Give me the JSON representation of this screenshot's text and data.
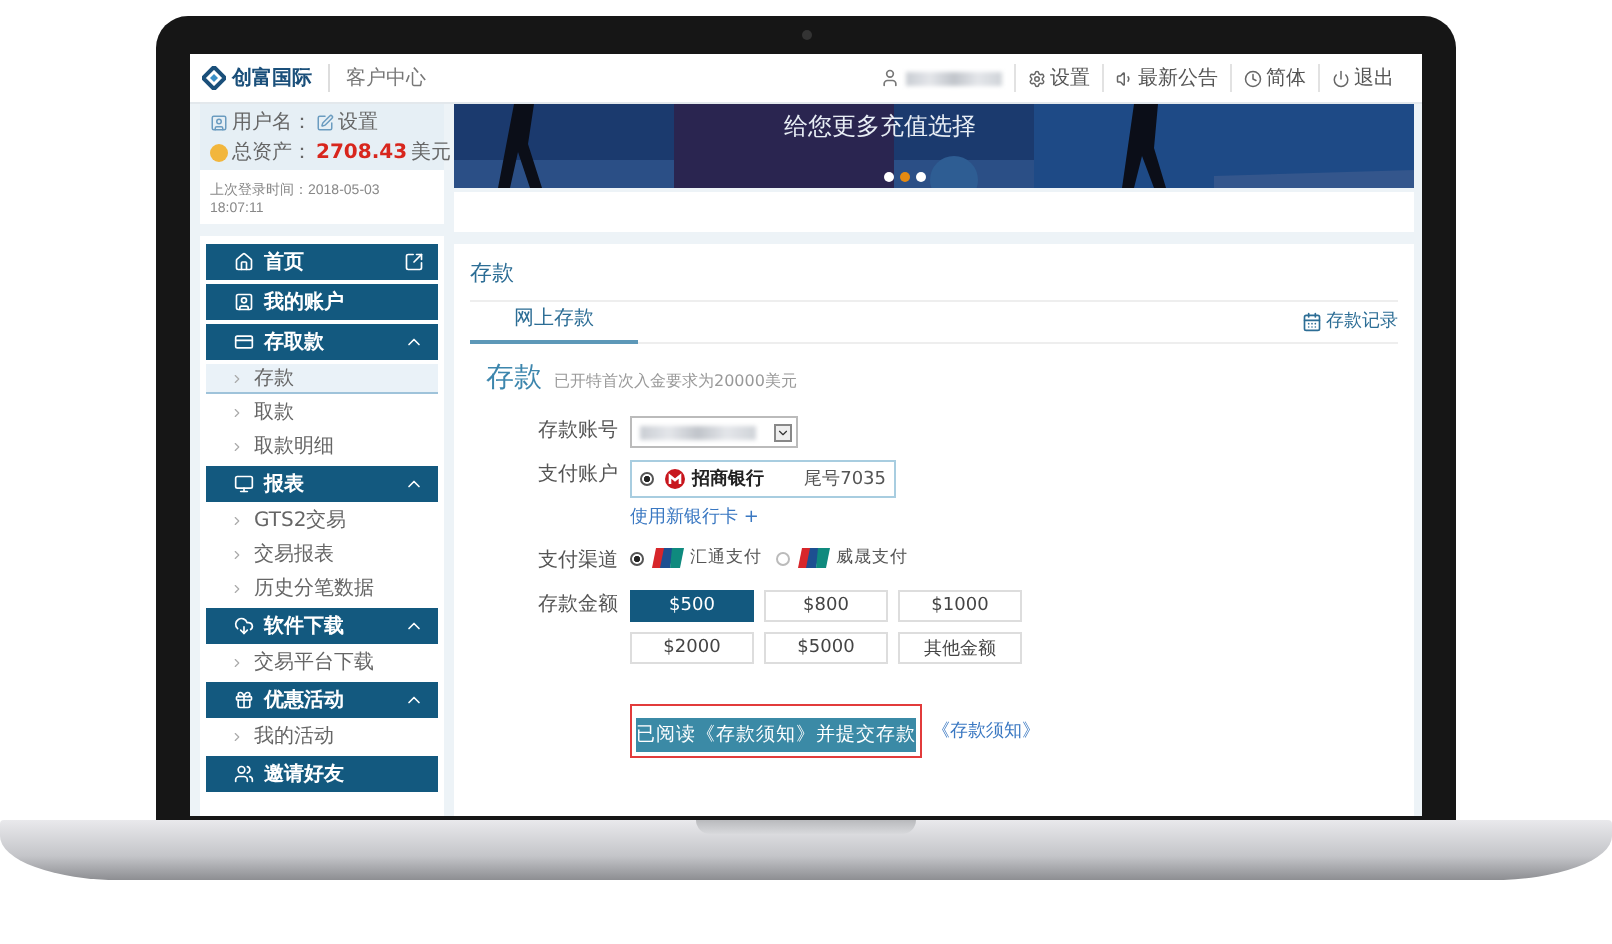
{
  "header": {
    "brand": "创富国际",
    "section": "客户中心",
    "actions": [
      {
        "label": "设置"
      },
      {
        "label": "最新公告"
      },
      {
        "label": "简体"
      },
      {
        "label": "退出"
      }
    ]
  },
  "account": {
    "username_label": "用户名：",
    "settings_link": "设置",
    "assets_label": "总资产：",
    "assets_value": "2708.43",
    "assets_unit": "美元",
    "last_login": "上次登录时间：2018-05-03 18:07:11"
  },
  "banner": {
    "caption": "给您更多充值选择",
    "dots": [
      {
        "selected": false
      },
      {
        "selected": true
      },
      {
        "selected": false
      }
    ]
  },
  "sidebar": {
    "groups": [
      {
        "label": "首页",
        "kind": "shortcut"
      },
      {
        "label": "我的账户",
        "kind": "link"
      },
      {
        "label": "存取款",
        "kind": "section",
        "expanded": true,
        "children": [
          {
            "label": "存款",
            "selected": true
          },
          {
            "label": "取款",
            "selected": false
          },
          {
            "label": "取款明细",
            "selected": false
          }
        ]
      },
      {
        "label": "报表",
        "kind": "section",
        "expanded": true,
        "children": [
          {
            "label": "GTS2交易",
            "selected": false
          },
          {
            "label": "交易报表",
            "selected": false
          },
          {
            "label": "历史分笔数据",
            "selected": false
          }
        ]
      },
      {
        "label": "软件下载",
        "kind": "section",
        "expanded": true,
        "children": [
          {
            "label": "交易平台下载",
            "selected": false
          }
        ]
      },
      {
        "label": "优惠活动",
        "kind": "section",
        "expanded": true,
        "children": [
          {
            "label": "我的活动",
            "selected": false
          }
        ]
      },
      {
        "label": "邀请好友",
        "kind": "link"
      }
    ]
  },
  "content": {
    "title": "存款",
    "tabs": [
      {
        "label": "网上存款",
        "selected": true
      }
    ],
    "records_link": "存款记录",
    "form": {
      "title": "存款",
      "note": "已开特首次入金要求为20000美元",
      "account_label": "存款账号",
      "pay_account_label": "支付账户",
      "bank": {
        "name": "招商银行",
        "tail": "尾号7035",
        "selected": true
      },
      "add_card": "使用新银行卡 +",
      "channel_label": "支付渠道",
      "channels": [
        {
          "label": "汇通支付",
          "selected": true
        },
        {
          "label": "威晟支付",
          "selected": false
        }
      ],
      "amount_label": "存款金额",
      "amounts": [
        {
          "label": "$500",
          "selected": true
        },
        {
          "label": "$800",
          "selected": false
        },
        {
          "label": "$1000",
          "selected": false
        },
        {
          "label": "$2000",
          "selected": false
        },
        {
          "label": "$5000",
          "selected": false
        },
        {
          "label": "其他金额",
          "selected": false
        }
      ],
      "submit": "已阅读《存款须知》并提交存款",
      "notice_link": "《存款须知》"
    }
  }
}
